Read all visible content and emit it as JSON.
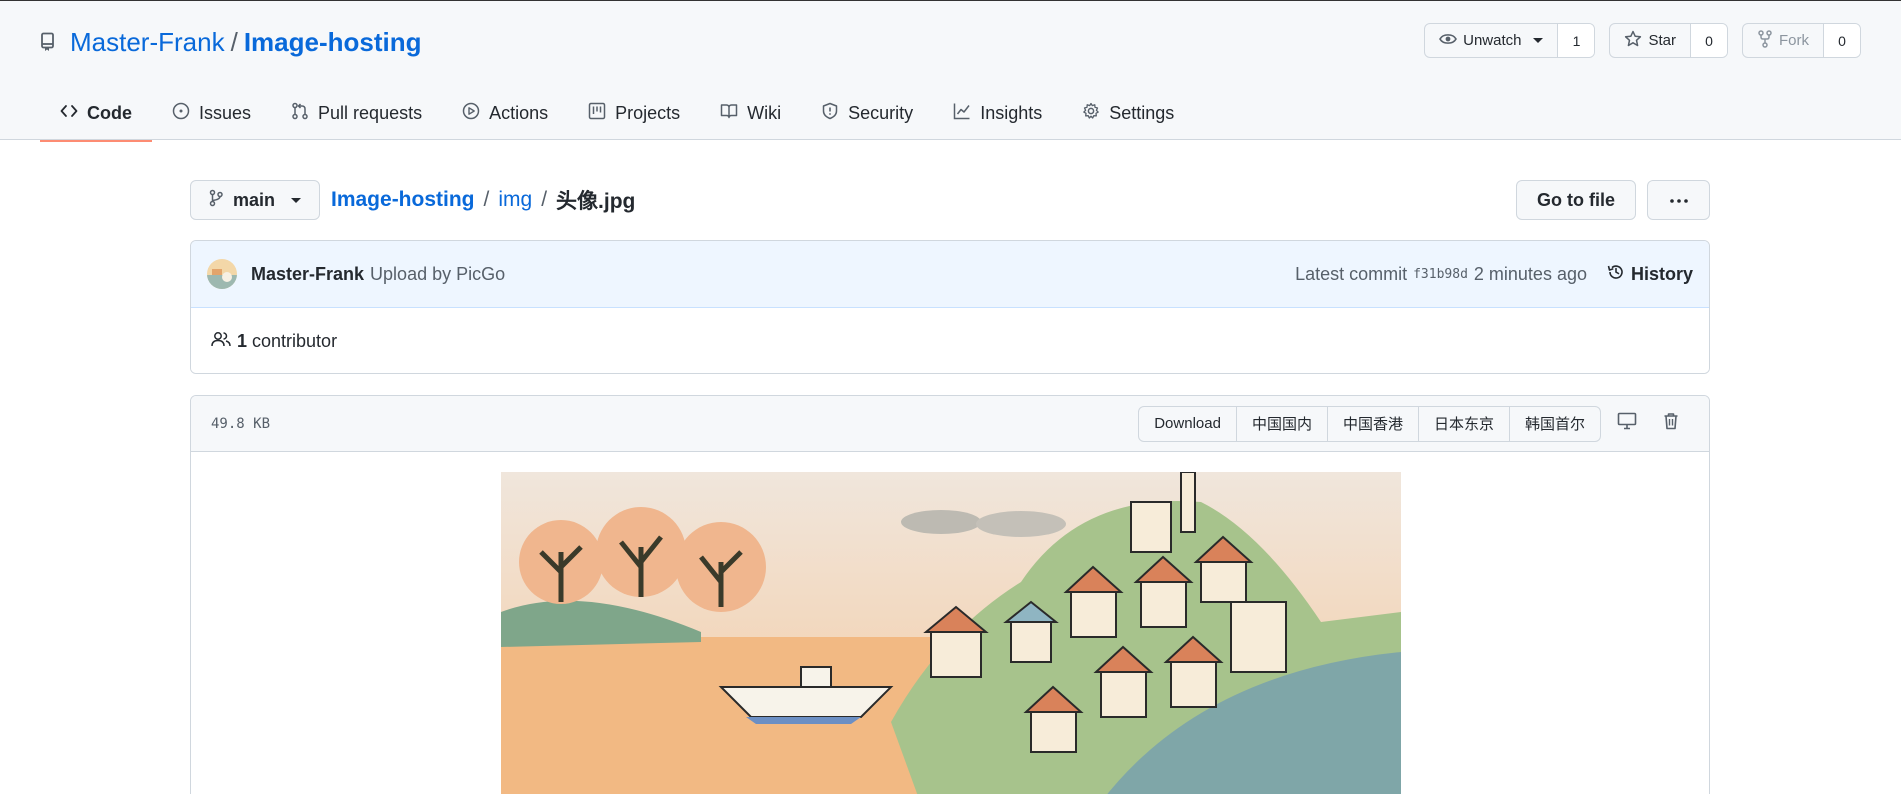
{
  "repo": {
    "owner": "Master-Frank",
    "separator": "/",
    "name": "Image-hosting"
  },
  "actions": {
    "watch": {
      "label": "Unwatch",
      "count": "1"
    },
    "star": {
      "label": "Star",
      "count": "0"
    },
    "fork": {
      "label": "Fork",
      "count": "0"
    }
  },
  "tabs": [
    {
      "label": "Code",
      "icon": "code-icon"
    },
    {
      "label": "Issues",
      "icon": "issue-icon"
    },
    {
      "label": "Pull requests",
      "icon": "pull-request-icon"
    },
    {
      "label": "Actions",
      "icon": "play-icon"
    },
    {
      "label": "Projects",
      "icon": "project-icon"
    },
    {
      "label": "Wiki",
      "icon": "book-icon"
    },
    {
      "label": "Security",
      "icon": "shield-icon"
    },
    {
      "label": "Insights",
      "icon": "graph-icon"
    },
    {
      "label": "Settings",
      "icon": "gear-icon"
    }
  ],
  "file_nav": {
    "branch": "main",
    "breadcrumb": [
      "Image-hosting",
      "img",
      "头像.jpg"
    ],
    "separator": "/",
    "go_to_file": "Go to file"
  },
  "commit": {
    "author": "Master-Frank",
    "message": "Upload by PicGo",
    "latest_label": "Latest commit",
    "sha": "f31b98d",
    "time": "2 minutes ago",
    "history": "History"
  },
  "contributors": {
    "count": "1",
    "label": "contributor"
  },
  "blob": {
    "size": "49.8 KB",
    "buttons": [
      "Download",
      "中国国内",
      "中国香港",
      "日本东京",
      "韩国首尔"
    ]
  },
  "colors": {
    "link": "#0969da",
    "tab_underline": "#fd8c73",
    "commit_bg": "#eef6ff"
  }
}
